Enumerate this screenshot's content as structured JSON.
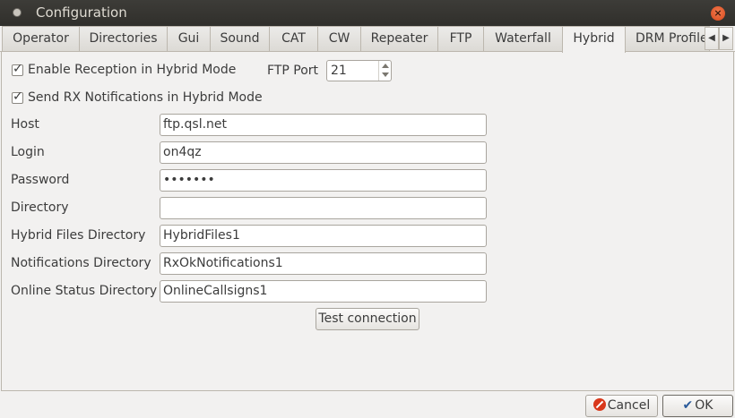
{
  "window": {
    "title": "Configuration",
    "close_glyph": "×"
  },
  "tabs": [
    {
      "label": "Operator"
    },
    {
      "label": "Directories"
    },
    {
      "label": "Gui"
    },
    {
      "label": "Sound"
    },
    {
      "label": "CAT"
    },
    {
      "label": "CW"
    },
    {
      "label": "Repeater"
    },
    {
      "label": "FTP"
    },
    {
      "label": "Waterfall"
    },
    {
      "label": "Hybrid",
      "active": true
    },
    {
      "label": "DRM Profile"
    }
  ],
  "hybrid": {
    "enable_reception_label": "Enable Reception in Hybrid Mode",
    "enable_reception_checked": true,
    "send_rx_label": "Send RX Notifications in Hybrid Mode",
    "send_rx_checked": true,
    "ftp_port_label": "FTP Port",
    "ftp_port_value": "21",
    "host_label": "Host",
    "host_value": "ftp.qsl.net",
    "login_label": "Login",
    "login_value": "on4qz",
    "password_label": "Password",
    "password_value": "•••••••",
    "directory_label": "Directory",
    "directory_value": "",
    "hybrid_files_label": "Hybrid Files Directory",
    "hybrid_files_value": "HybridFiles1",
    "notifications_label": "Notifications Directory",
    "notifications_value": "RxOkNotifications1",
    "online_status_label": "Online Status Directory",
    "online_status_value": "OnlineCallsigns1",
    "test_button_label": "Test connection"
  },
  "footer": {
    "cancel_label": "Cancel",
    "ok_label": "OK"
  },
  "icons": {
    "window_menu": "window-menu-icon",
    "close": "close-icon",
    "tab_scroll_left": "tab-scroll-left-icon",
    "tab_scroll_right": "tab-scroll-right-icon",
    "cancel": "cancel-icon",
    "ok": "checkmark-icon"
  },
  "colors": {
    "titlebar_bg": "#3d3c38",
    "close_button": "#e05a2b",
    "window_bg": "#f2f1f0",
    "cancel_icon": "#d9381b",
    "ok_icon": "#2a5a9a"
  }
}
